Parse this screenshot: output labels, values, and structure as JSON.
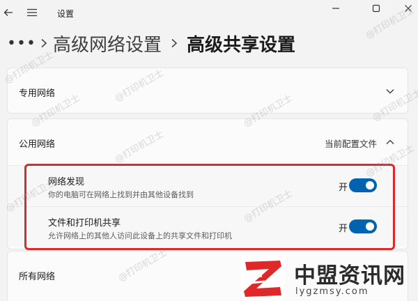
{
  "titlebar": {
    "title": "设置",
    "back_icon": "back-arrow-icon",
    "menu_icon": "hamburger-menu-icon"
  },
  "breadcrumb": {
    "more": "•••",
    "items": [
      "高级网络设置",
      "高级共享设置"
    ]
  },
  "sections": {
    "private": {
      "title": "专用网络",
      "expanded": false
    },
    "public": {
      "title": "公用网络",
      "aside": "当前配置文件",
      "expanded": true,
      "rows": [
        {
          "title": "网络发现",
          "description": "你的电脑可在网络上找到并由其他设备找到",
          "state": "开",
          "on": true
        },
        {
          "title": "文件和打印机共享",
          "description": "允许网络上的其他人访问此设备上的共享文件和打印机",
          "state": "开",
          "on": true
        }
      ]
    },
    "all": {
      "title": "所有网络"
    }
  },
  "watermark": "@打印机卫士",
  "logo": {
    "text": "中盟资讯网",
    "url": "lygzmsy.com",
    "mark": "Z"
  },
  "colors": {
    "accent": "#0063b1",
    "highlight": "#e02828"
  }
}
